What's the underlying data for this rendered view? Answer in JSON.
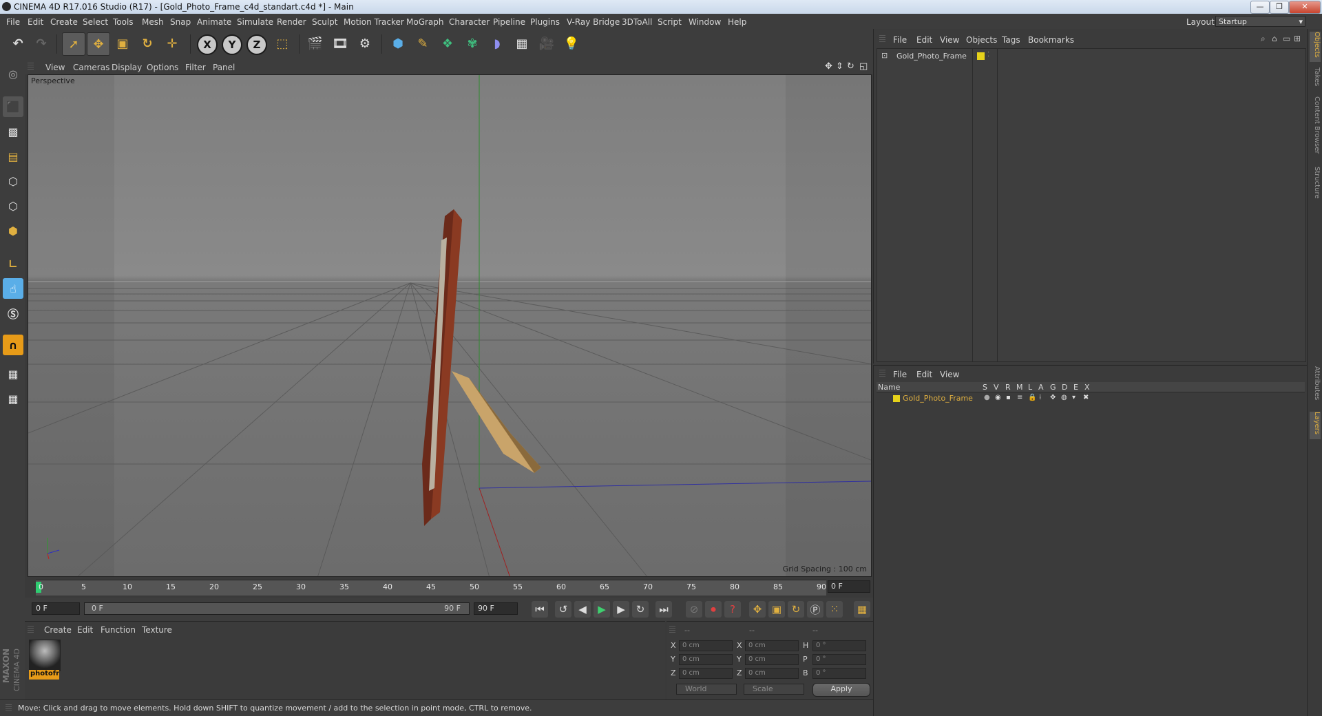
{
  "window": {
    "title": "CINEMA 4D R17.016 Studio (R17) - [Gold_Photo_Frame_c4d_standart.c4d *] - Main"
  },
  "menubar": [
    "File",
    "Edit",
    "Create",
    "Select",
    "Tools",
    "Mesh",
    "Snap",
    "Animate",
    "Simulate",
    "Render",
    "Sculpt",
    "Motion Tracker",
    "MoGraph",
    "Character",
    "Pipeline",
    "Plugins",
    "V-Ray Bridge",
    "3DToAll",
    "Script",
    "Window",
    "Help"
  ],
  "layout": {
    "label": "Layout:",
    "value": "Startup"
  },
  "viewport": {
    "menu": [
      "View",
      "Cameras",
      "Display",
      "Options",
      "Filter",
      "Panel"
    ],
    "camera_label": "Perspective",
    "grid_spacing": "Grid Spacing : 100 cm"
  },
  "timeline": {
    "ticks": [
      "0",
      "5",
      "10",
      "15",
      "20",
      "25",
      "30",
      "35",
      "40",
      "45",
      "50",
      "55",
      "60",
      "65",
      "70",
      "75",
      "80",
      "85",
      "90"
    ],
    "current_frame": "0 F"
  },
  "transport": {
    "start_field": "0 F",
    "range_start": "0 F",
    "range_end": "90 F",
    "end_field": "90 F"
  },
  "materials": {
    "menu": [
      "Create",
      "Edit",
      "Function",
      "Texture"
    ],
    "items": [
      {
        "name": "photofr"
      }
    ]
  },
  "coordinates": {
    "header": [
      "--",
      "--",
      "--"
    ],
    "rows": [
      {
        "a": "X",
        "av": "0 cm",
        "b": "X",
        "bv": "0 cm",
        "c": "H",
        "cv": "0 °"
      },
      {
        "a": "Y",
        "av": "0 cm",
        "b": "Y",
        "bv": "0 cm",
        "c": "P",
        "cv": "0 °"
      },
      {
        "a": "Z",
        "av": "0 cm",
        "b": "Z",
        "bv": "0 cm",
        "c": "B",
        "cv": "0 °"
      }
    ],
    "space": "World",
    "mode": "Scale",
    "apply": "Apply"
  },
  "status": "Move: Click and drag to move elements. Hold down SHIFT to quantize movement / add to the selection in point mode, CTRL to remove.",
  "object_manager": {
    "menu": [
      "File",
      "Edit",
      "View",
      "Objects",
      "Tags",
      "Bookmarks"
    ],
    "objects": [
      {
        "name": "Gold_Photo_Frame",
        "color": "#e6d21a"
      }
    ]
  },
  "layer_manager": {
    "menu": [
      "File",
      "Edit",
      "View"
    ],
    "columns": [
      "Name",
      "S",
      "V",
      "R",
      "M",
      "L",
      "A",
      "G",
      "D",
      "E",
      "X"
    ],
    "layers": [
      {
        "name": "Gold_Photo_Frame",
        "color": "#e6d21a"
      }
    ]
  },
  "side_tabs": [
    "Objects",
    "Takes",
    "Content Browser",
    "Structure",
    "Attributes",
    "Layers"
  ],
  "branding": [
    "MAXON",
    "CINEMA 4D"
  ],
  "colors": {
    "accent": "#e79b18",
    "active_tab": "#e0b040"
  }
}
